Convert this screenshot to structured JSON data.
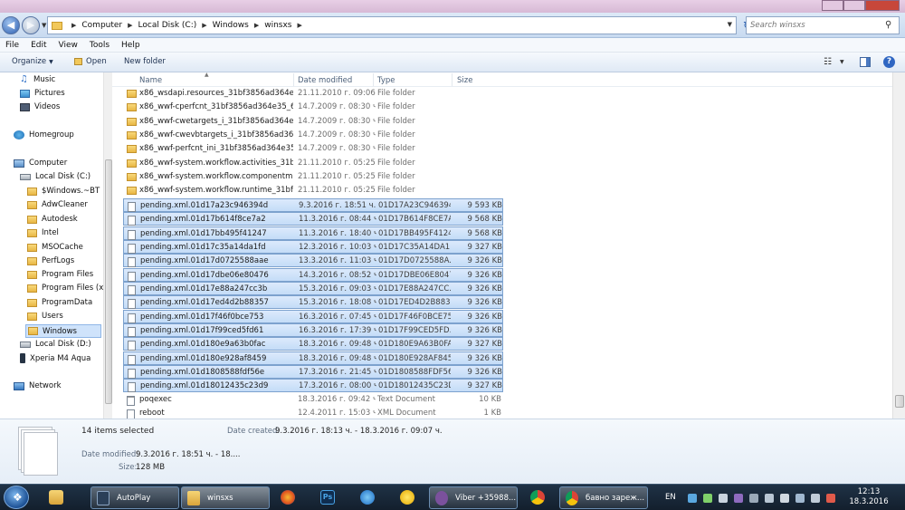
{
  "address": {
    "crumbs": [
      "Computer",
      "Local Disk (C:)",
      "Windows",
      "winsxs"
    ],
    "search_placeholder": "Search winsxs"
  },
  "menu": [
    "File",
    "Edit",
    "View",
    "Tools",
    "Help"
  ],
  "toolbar": {
    "organize": "Organize",
    "open": "Open",
    "new_folder": "New folder"
  },
  "nav": {
    "music": "Music",
    "pictures": "Pictures",
    "videos": "Videos",
    "homegroup": "Homegroup",
    "computer": "Computer",
    "local_c": "Local Disk (C:)",
    "folders": [
      "$Windows.~BT",
      "AdwCleaner",
      "Autodesk",
      "Intel",
      "MSOCache",
      "PerfLogs",
      "Program Files",
      "Program Files (x86)",
      "ProgramData",
      "Users",
      "Windows"
    ],
    "local_d": "Local Disk (D:)",
    "phone": "Xperia M4 Aqua",
    "network": "Network"
  },
  "columns": {
    "name": "Name",
    "date": "Date modified",
    "type": "Type",
    "size": "Size"
  },
  "files": [
    {
      "name": "x86_wsdapi.resources_31bf3856ad364e35...",
      "date": "21.11.2010 г. 09:06...",
      "type": "File folder",
      "size": "",
      "kind": "folder",
      "sel": false
    },
    {
      "name": "x86_wwf-cperfcnt_31bf3856ad364e35_6.1....",
      "date": "14.7.2009 г. 08:30 ч.",
      "type": "File folder",
      "size": "",
      "kind": "folder",
      "sel": false
    },
    {
      "name": "x86_wwf-cwetargets_i_31bf3856ad364e35...",
      "date": "14.7.2009 г. 08:30 ч.",
      "type": "File folder",
      "size": "",
      "kind": "folder",
      "sel": false
    },
    {
      "name": "x86_wwf-cwevbtargets_i_31bf3856ad364e...",
      "date": "14.7.2009 г. 08:30 ч.",
      "type": "File folder",
      "size": "",
      "kind": "folder",
      "sel": false
    },
    {
      "name": "x86_wwf-perfcnt_ini_31bf3856ad364e35_6...",
      "date": "14.7.2009 г. 08:30 ч.",
      "type": "File folder",
      "size": "",
      "kind": "folder",
      "sel": false
    },
    {
      "name": "x86_wwf-system.workflow.activities_31bf...",
      "date": "21.11.2010 г. 05:25...",
      "type": "File folder",
      "size": "",
      "kind": "folder",
      "sel": false
    },
    {
      "name": "x86_wwf-system.workflow.componentm...",
      "date": "21.11.2010 г. 05:25...",
      "type": "File folder",
      "size": "",
      "kind": "folder",
      "sel": false
    },
    {
      "name": "x86_wwf-system.workflow.runtime_31bf3...",
      "date": "21.11.2010 г. 05:25...",
      "type": "File folder",
      "size": "",
      "kind": "folder",
      "sel": false
    },
    {
      "name": "pending.xml.01d17a23c946394d",
      "date": "9.3.2016 г. 18:51 ч.",
      "type": "01D17A23C946394...",
      "size": "9 593 KB",
      "kind": "xml",
      "sel": true
    },
    {
      "name": "pending.xml.01d17b614f8ce7a2",
      "date": "11.3.2016 г. 08:44 ч.",
      "type": "01D17B614F8CE7A...",
      "size": "9 568 KB",
      "kind": "xml",
      "sel": true
    },
    {
      "name": "pending.xml.01d17bb495f41247",
      "date": "11.3.2016 г. 18:40 ч.",
      "type": "01D17BB495F4124...",
      "size": "9 568 KB",
      "kind": "xml",
      "sel": true
    },
    {
      "name": "pending.xml.01d17c35a14da1fd",
      "date": "12.3.2016 г. 10:03 ч.",
      "type": "01D17C35A14DA1...",
      "size": "9 327 KB",
      "kind": "xml",
      "sel": true
    },
    {
      "name": "pending.xml.01d17d0725588aae",
      "date": "13.3.2016 г. 11:03 ч.",
      "type": "01D17D0725588A...",
      "size": "9 326 KB",
      "kind": "xml",
      "sel": true
    },
    {
      "name": "pending.xml.01d17dbe06e80476",
      "date": "14.3.2016 г. 08:52 ч.",
      "type": "01D17DBE06E8047...",
      "size": "9 326 KB",
      "kind": "xml",
      "sel": true
    },
    {
      "name": "pending.xml.01d17e88a247cc3b",
      "date": "15.3.2016 г. 09:03 ч.",
      "type": "01D17E88A247CC...",
      "size": "9 326 KB",
      "kind": "xml",
      "sel": true
    },
    {
      "name": "pending.xml.01d17ed4d2b88357",
      "date": "15.3.2016 г. 18:08 ч.",
      "type": "01D17ED4D2B8835...",
      "size": "9 326 KB",
      "kind": "xml",
      "sel": true
    },
    {
      "name": "pending.xml.01d17f46f0bce753",
      "date": "16.3.2016 г. 07:45 ч.",
      "type": "01D17F46F0BCE75...",
      "size": "9 326 KB",
      "kind": "xml",
      "sel": true
    },
    {
      "name": "pending.xml.01d17f99ced5fd61",
      "date": "16.3.2016 г. 17:39 ч.",
      "type": "01D17F99CED5FD...",
      "size": "9 326 KB",
      "kind": "xml",
      "sel": true
    },
    {
      "name": "pending.xml.01d180e9a63b0fac",
      "date": "18.3.2016 г. 09:48 ч.",
      "type": "01D180E9A63B0FA...",
      "size": "9 327 KB",
      "kind": "xml",
      "sel": true
    },
    {
      "name": "pending.xml.01d180e928af8459",
      "date": "18.3.2016 г. 09:48 ч.",
      "type": "01D180E928AF845...",
      "size": "9 326 KB",
      "kind": "xml",
      "sel": true
    },
    {
      "name": "pending.xml.01d1808588fdf56e",
      "date": "17.3.2016 г. 21:45 ч.",
      "type": "01D1808588FDF56...",
      "size": "9 326 KB",
      "kind": "xml",
      "sel": true
    },
    {
      "name": "pending.xml.01d18012435c23d9",
      "date": "17.3.2016 г. 08:00 ч.",
      "type": "01D18012435C23D...",
      "size": "9 327 KB",
      "kind": "xml",
      "sel": true
    },
    {
      "name": "poqexec",
      "date": "18.3.2016 г. 09:42 ч.",
      "type": "Text Document",
      "size": "10 KB",
      "kind": "txt",
      "sel": false
    },
    {
      "name": "reboot",
      "date": "12.4.2011 г. 15:03 ч.",
      "type": "XML Document",
      "size": "1 KB",
      "kind": "xml",
      "sel": false
    }
  ],
  "details": {
    "count": "14 items selected",
    "created_label": "Date created:",
    "created_value": "9.3.2016 г. 18:13 ч. - 18.3.2016 г. 09:07 ч.",
    "modified_label": "Date modified:",
    "modified_value": "9.3.2016 г. 18:51 ч. - 18....",
    "size_label": "Size:",
    "size_value": "128 MB"
  },
  "taskbar": {
    "autoplay": "AutoPlay",
    "winsxs": "winsxs",
    "viber": "Viber +35988...",
    "chrome_tab": "бавно зареж...",
    "lang": "EN",
    "time": "12:13",
    "date": "18.3.2016"
  },
  "colors": {
    "selection": "#cfe3fb",
    "folder": "#f2c85a",
    "taskbar": "#1a2a3c"
  }
}
